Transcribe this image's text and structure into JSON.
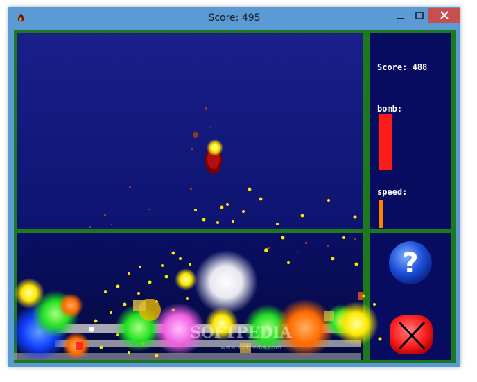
{
  "window": {
    "title": "Score: 495",
    "title_icon": "flame-app-icon",
    "controls": [
      "minimize-icon",
      "maximize-icon",
      "close-icon"
    ]
  },
  "hud": {
    "score_label": "Score: 488",
    "bomb_label": "bomb:",
    "speed_label": "speed:",
    "bomb_level": 0.85,
    "speed_level": 0.25,
    "help_icon": "question-mark-icon",
    "quit_icon": "red-x-button-icon"
  },
  "watermark": {
    "brand": "SOFTPEDIA",
    "url": "www.softpedia.com"
  },
  "colors": {
    "background": "#0a1060",
    "frame": "#1c7a1c",
    "bomb_bar": "#ff1a1a",
    "speed_bar": "#ff7f00",
    "help_button": "#1e4fd8",
    "quit_button": "#ff2020",
    "titlebar": "#5b9bd5"
  }
}
